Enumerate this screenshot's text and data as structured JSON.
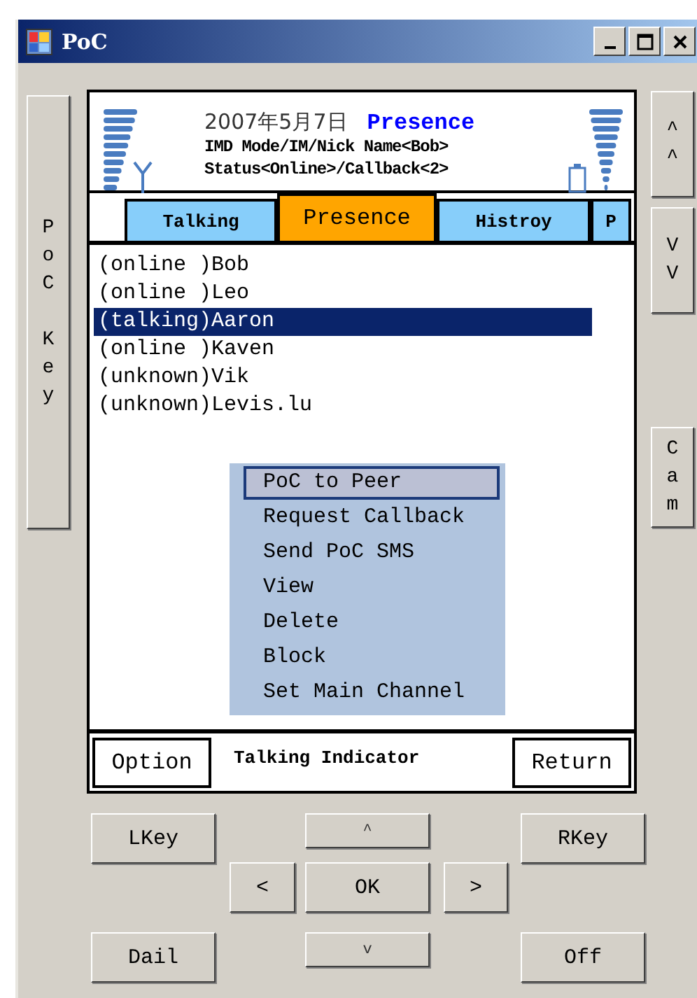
{
  "window": {
    "title": "PoC"
  },
  "left_key": {
    "label": "PoC Key"
  },
  "right_keys": [
    {
      "label": "^^"
    },
    {
      "label": "VV"
    },
    {
      "label": "Cam"
    }
  ],
  "header": {
    "date": "2007年5月7日",
    "mode": "Presence",
    "line_1": "IMD Mode/IM/Nick Name<Bob>",
    "line_2": "Status<Online>/Callback<2>"
  },
  "tabs": [
    {
      "label": "Talking",
      "selected": false
    },
    {
      "label": "Presence",
      "selected": true
    },
    {
      "label": "Histroy",
      "selected": false
    },
    {
      "label": "P",
      "selected": false
    }
  ],
  "contacts": [
    {
      "text": "(online )Bob",
      "selected": false
    },
    {
      "text": "(online )Leo",
      "selected": false
    },
    {
      "text": "(talking)Aaron",
      "selected": true
    },
    {
      "text": "(online )Kaven",
      "selected": false
    },
    {
      "text": "(unknown)Vik",
      "selected": false
    },
    {
      "text": "(unknown)Levis.lu",
      "selected": false
    }
  ],
  "context_menu": [
    {
      "label": "PoC to Peer",
      "selected": true
    },
    {
      "label": "Request Callback",
      "selected": false
    },
    {
      "label": "Send PoC SMS",
      "selected": false
    },
    {
      "label": "View",
      "selected": false
    },
    {
      "label": "Delete",
      "selected": false
    },
    {
      "label": "Block",
      "selected": false
    },
    {
      "label": "Set Main Channel",
      "selected": false
    }
  ],
  "softkey_bar": {
    "left": "Option",
    "indicator": "Talking Indicator",
    "right": "Return"
  },
  "keypad": {
    "lkey": "LKey",
    "up": "^",
    "rkey": "RKey",
    "left": "<",
    "ok": "OK",
    "right": ">",
    "dial": "Dail",
    "down": "v",
    "off": "Off"
  }
}
